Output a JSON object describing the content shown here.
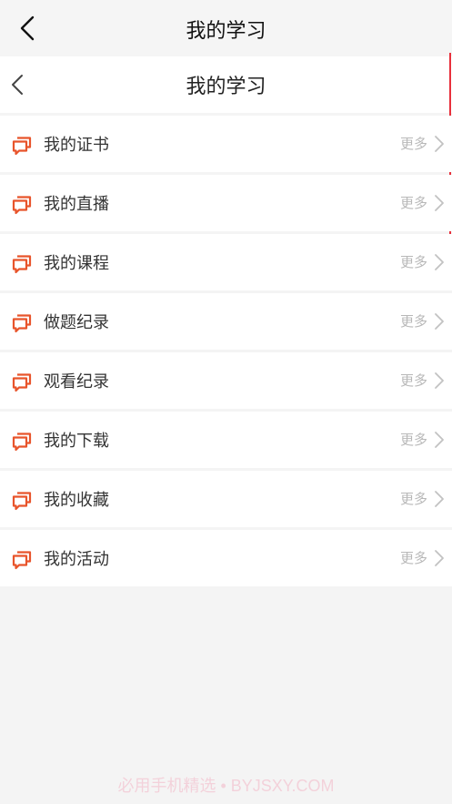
{
  "header": {
    "title": "我的学习"
  },
  "subheader": {
    "title": "我的学习"
  },
  "menu": {
    "more_label": "更多",
    "icon": "chat-bubbles-icon",
    "items": [
      {
        "label": "我的证书"
      },
      {
        "label": "我的直播"
      },
      {
        "label": "我的课程"
      },
      {
        "label": "做题纪录"
      },
      {
        "label": "观看纪录"
      },
      {
        "label": "我的下载"
      },
      {
        "label": "我的收藏"
      },
      {
        "label": "我的活动"
      }
    ]
  },
  "watermark": {
    "text": "必用手机精选 • BYJSXY.COM"
  },
  "colors": {
    "accent": "#e8542b",
    "scroll_indicator": "#e8303c",
    "more_text": "#b8b8b8"
  }
}
